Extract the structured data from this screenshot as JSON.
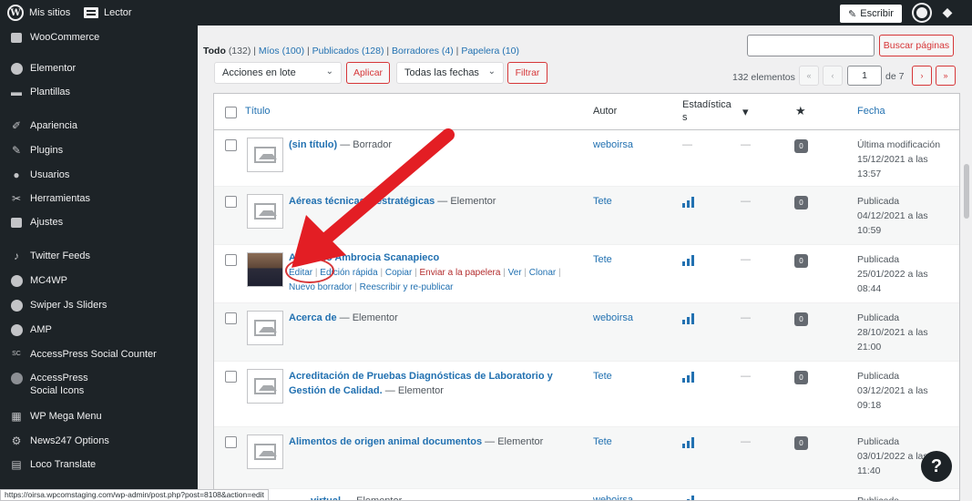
{
  "adminbar": {
    "wp_logo": "W",
    "my_sites": "Mis sitios",
    "reader": "Lector",
    "write": "Escribir"
  },
  "sidebar": {
    "items": [
      {
        "label": "WooCommerce",
        "icon": "woocommerce-icon"
      },
      {
        "label": "Elementor",
        "icon": "elementor-icon"
      },
      {
        "label": "Plantillas",
        "icon": "folder-icon"
      },
      {
        "label": "Apariencia",
        "icon": "paintbrush-icon"
      },
      {
        "label": "Plugins",
        "icon": "plug-icon"
      },
      {
        "label": "Usuarios",
        "icon": "users-icon"
      },
      {
        "label": "Herramientas",
        "icon": "wrench-icon"
      },
      {
        "label": "Ajustes",
        "icon": "settings-icon"
      },
      {
        "label": "Twitter Feeds",
        "icon": "twitter-icon"
      },
      {
        "label": "MC4WP",
        "icon": "mc4wp-icon"
      },
      {
        "label": "Swiper Js Sliders",
        "icon": "swiper-icon"
      },
      {
        "label": "AMP",
        "icon": "amp-icon"
      },
      {
        "label": "AccessPress Social Counter",
        "icon": "sc-icon",
        "icon_text": "SC"
      },
      {
        "label": "AccessPress",
        "label2": "Social Icons",
        "icon": "social-icon"
      },
      {
        "label": "WP Mega Menu",
        "icon": "grid-icon"
      },
      {
        "label": "News247 Options",
        "icon": "gear-icon"
      },
      {
        "label": "Loco Translate",
        "icon": "translate-icon"
      }
    ]
  },
  "filters": {
    "all": "Todo",
    "all_count": "(132)",
    "mine": "Míos",
    "mine_count": "(100)",
    "published": "Publicados",
    "published_count": "(128)",
    "drafts": "Borradores",
    "drafts_count": "(4)",
    "trash": "Papelera",
    "trash_count": "(10)"
  },
  "search": {
    "button": "Buscar páginas"
  },
  "bulk": {
    "select": "Acciones en lote",
    "apply": "Aplicar"
  },
  "dates": {
    "select": "Todas las fechas",
    "filter": "Filtrar"
  },
  "pagination": {
    "count": "132 elementos",
    "first": "«",
    "prev": "‹",
    "current": "1",
    "of": "de 7",
    "next": "›",
    "last": "»"
  },
  "table": {
    "headers": {
      "title": "Título",
      "author": "Autor",
      "stats_1": "Estadística",
      "stats_2": "s",
      "date": "Fecha"
    },
    "rows": [
      {
        "title": "(sin título)",
        "state": " — Borrador",
        "author": "weboirsa",
        "stats": "—",
        "comments": "—",
        "count": "0",
        "date_1": "Última modificación",
        "date_2": "15/12/2021 a las",
        "date_3": "13:57"
      },
      {
        "title": "Aéreas técnicas y estratégicas",
        "state": " — Elementor",
        "author": "Tete",
        "comments": "—",
        "count": "0",
        "date_1": "Publicada",
        "date_2": "04/12/2021 a las",
        "date_3": "10:59"
      },
      {
        "title": "Abelardo Ambrocia Scanapieco",
        "state": "",
        "author": "Tete",
        "comments": "—",
        "count": "0",
        "date_1": "Publicada",
        "date_2": "25/01/2022 a las",
        "date_3": "08:44",
        "actions": {
          "edit": "Editar",
          "quick": "Edición rápida",
          "copy": "Copiar",
          "trash": "Enviar a la papelera",
          "view": "Ver",
          "clone": "Clonar",
          "new_draft": "Nuevo borrador",
          "rewrite": "Reescribir y re-publicar"
        }
      },
      {
        "title": "Acerca de",
        "state": " — Elementor",
        "author": "weboirsa",
        "comments": "—",
        "count": "0",
        "date_1": "Publicada",
        "date_2": "28/10/2021 a las",
        "date_3": "21:00"
      },
      {
        "title": "Acreditación de Pruebas Diagnósticas de Laboratorio y Gestión",
        "title2": "de Calidad.",
        "state": " — Elementor",
        "author": "Tete",
        "comments": "—",
        "count": "0",
        "date_1": "Publicada",
        "date_2": "03/12/2021 a las",
        "date_3": "09:18"
      },
      {
        "title": "Alimentos de origen animal documentos",
        "state": " — Elementor",
        "author": "Tete",
        "comments": "—",
        "count": "0",
        "date_1": "Publicada",
        "date_2": "03/01/2022 a las",
        "date_3": "11:40"
      },
      {
        "title": "virtual",
        "state": " — Elementor",
        "author": "weboirsa",
        "date_1": "Publicada"
      }
    ]
  },
  "help": "?",
  "status_url": "https://oirsa.wpcomstaging.com/wp-admin/post.php?post=8108&action=edit",
  "colors": {
    "admin_bg": "#1d2327",
    "link": "#2271b1",
    "accent_red": "#d63638",
    "arrow": "#e31e24"
  }
}
